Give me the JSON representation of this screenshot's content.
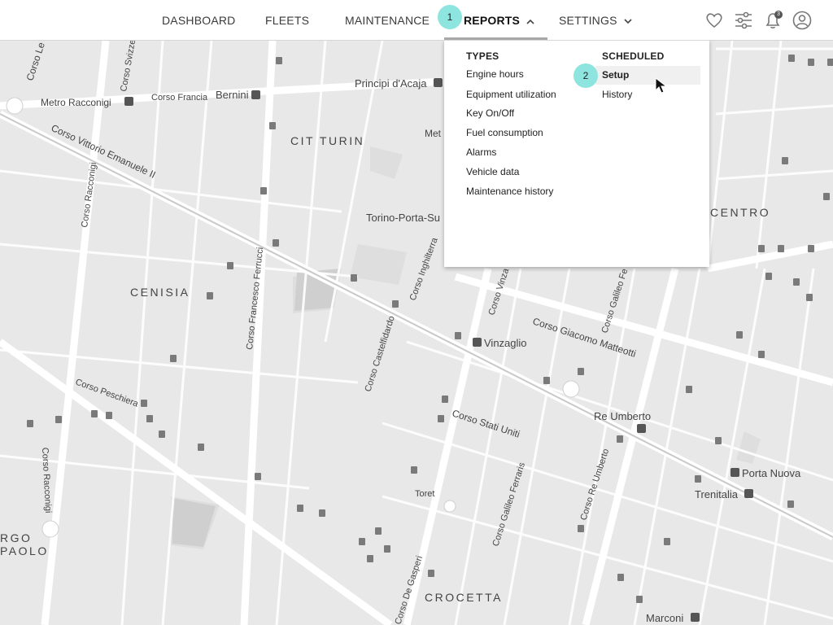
{
  "nav": {
    "items": [
      {
        "label": "DASHBOARD"
      },
      {
        "label": "FLEETS"
      },
      {
        "label": "MAINTENANCE"
      },
      {
        "label": "REPORTS"
      },
      {
        "label": "SETTINGS"
      }
    ],
    "icons": [
      "heart-icon",
      "sliders-icon",
      "bell-icon",
      "user-icon"
    ],
    "notification_count": "3"
  },
  "dropdown": {
    "types_heading": "TYPES",
    "types": [
      "Engine hours",
      "Equipment utilization",
      "Key On/Off",
      "Fuel consumption",
      "Alarms",
      "Vehicle data",
      "Maintenance history"
    ],
    "scheduled_heading": "SCHEDULED",
    "scheduled": [
      "Setup",
      "History"
    ]
  },
  "steps": [
    "1",
    "2"
  ],
  "map": {
    "labels": {
      "corso_le": "Corso Le",
      "corso_svizzera": "Corso Svizze",
      "metro_racconigi": "Metro Racconigi",
      "corso_francia": "Corso Francia",
      "bernini": "Bernini",
      "principi_acaja": "Principi d'Acaja",
      "cit_turin": "CIT TURIN",
      "metro_partial": "Met",
      "corso_vittorio": "Corso Vittorio Emanuele II",
      "corso_racconigi": "Corso Racconigi",
      "torino_porta_susa": "Torino-Porta-Su",
      "centro": "CENTRO",
      "cenisia": "CENISIA",
      "corso_ferrucci": "Corso Francesco Ferrucci",
      "corso_inghilterra": "Corso Inghilterra",
      "corso_vinzaglio": "Corso Vinza",
      "corso_galileo_fe": "Corso Galileo Fe",
      "corso_giacomo_matteotti": "Corso Giacomo Matteotti",
      "vinzaglio": "Vinzaglio",
      "corso_castelfidardo": "Corso Castelfidardo",
      "corso_peschiera": "Corso Peschiera",
      "corso_racconigi_2": "Corso Racconigi",
      "re_umberto": "Re Umberto",
      "corso_stati_uniti": "Corso Stati Uniti",
      "porta_nuova": "Porta Nuova",
      "trenitalia": "Trenitalia",
      "toret": "Toret",
      "corso_galileo_ferraris": "Corso Galileo Ferraris",
      "corso_re_umberto": "Corso Re Umberto",
      "borgo": "RGO",
      "paolo": "PAOLO",
      "de_gasperi": "Corso De Gasperi",
      "crocetta": "CROCETTA",
      "marconi": "Marconi"
    }
  }
}
